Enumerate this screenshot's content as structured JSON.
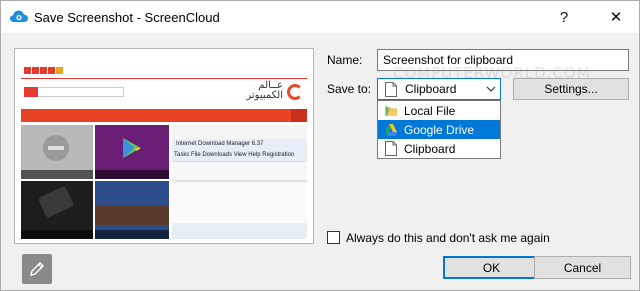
{
  "window": {
    "title": "Save Screenshot - ScreenCloud",
    "help_glyph": "?",
    "close_glyph": "✕"
  },
  "form": {
    "name_label": "Name:",
    "name_value": "Screenshot for clipboard",
    "save_to_label": "Save to:",
    "save_to_selected": "Clipboard",
    "settings_label": "Settings...",
    "options": [
      {
        "label": "Local File",
        "icon": "folder-icon"
      },
      {
        "label": "Google Drive",
        "icon": "google-drive-icon",
        "highlighted": true
      },
      {
        "label": "Clipboard",
        "icon": "document-icon"
      }
    ],
    "always_label": "Always do this and don't ask me again",
    "always_checked": false
  },
  "preview": {
    "logo_text": "عــالم\nالكمبيوتر",
    "window_title": "Internet Download Manager 6.37",
    "menu": "Tasks  File  Downloads  View  Help  Registration",
    "edit_icon": "pencil-icon"
  },
  "watermark": "COMPUTERWORLD.COM",
  "buttons": {
    "ok": "OK",
    "cancel": "Cancel"
  },
  "colors": {
    "accent": "#0078d7",
    "site_red": "#e84324"
  }
}
